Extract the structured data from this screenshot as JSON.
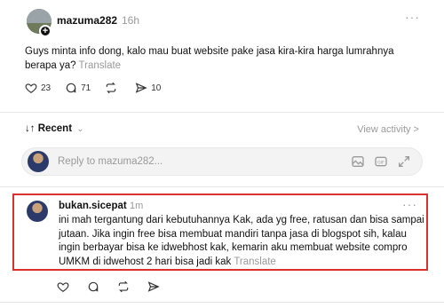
{
  "post": {
    "username": "mazuma282",
    "time": "16h",
    "more_label": "···",
    "text": "Guys minta info dong, kalo mau buat website pake jasa kira-kira harga lumrahnya berapa ya?",
    "translate": "Translate",
    "likes": "23",
    "comments": "71",
    "shares": "10",
    "follow_badge": "+"
  },
  "sort": {
    "label": "↓↑ Recent",
    "chevron": "⌄",
    "view_activity": "View activity >"
  },
  "reply_box": {
    "placeholder": "Reply to mazuma282...",
    "icons": [
      "image-icon",
      "gif-icon",
      "expand-icon"
    ]
  },
  "comment": {
    "username": "bukan.sicepat",
    "time": "1m",
    "more_label": "···",
    "text": "ini mah tergantung dari kebutuhannya Kak, ada yg free, ratusan dan bisa sampai jutaan. Jika ingin free bisa membuat mandiri tanpa jasa di blogspot sih, kalau ingin berbayar bisa ke idwebhost kak, kemarin aku membuat website compro UMKM di idwehost 2 hari bisa jadi kak",
    "translate": "Translate"
  },
  "colors": {
    "highlight_border": "#d9312b",
    "muted": "#9a9a9a",
    "text": "#111111"
  }
}
